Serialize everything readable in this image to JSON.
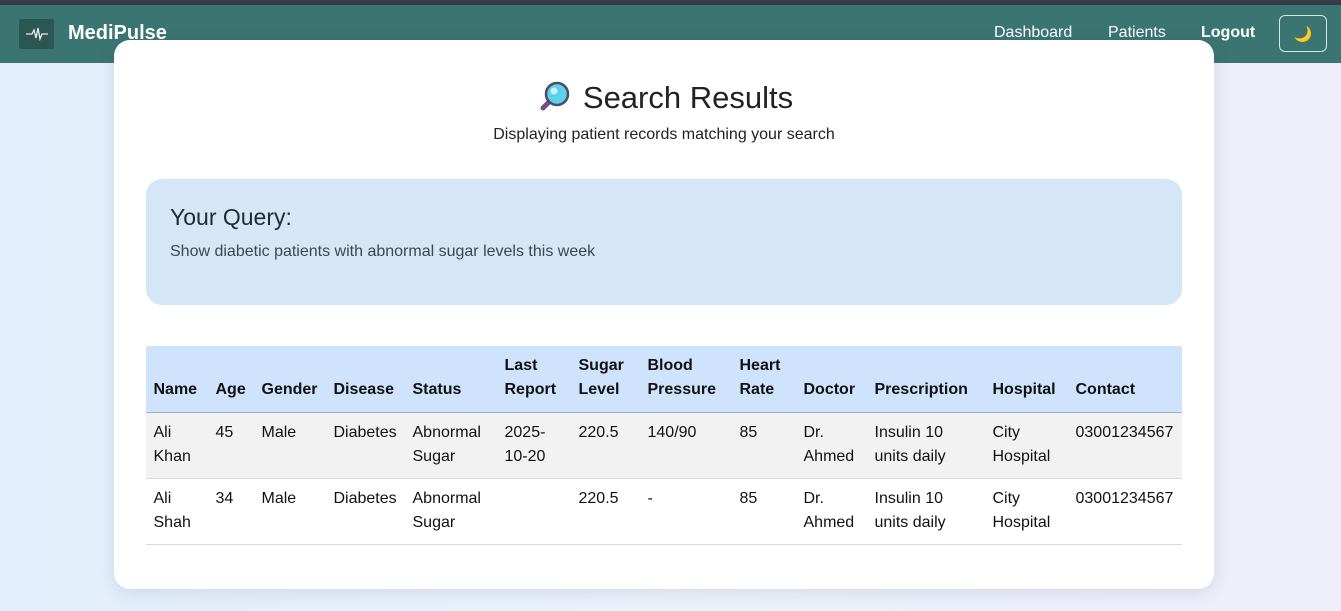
{
  "nav": {
    "brand": "MediPulse",
    "links": [
      "Dashboard",
      "Patients"
    ],
    "logout": "Logout",
    "theme_icon": "🌙"
  },
  "page": {
    "title": "Search Results",
    "subtitle": "Displaying patient records matching your search"
  },
  "query": {
    "heading": "Your Query:",
    "text": "Show diabetic patients with abnormal sugar levels this week"
  },
  "table": {
    "headers": [
      "Name",
      "Age",
      "Gender",
      "Disease",
      "Status",
      "Last Report",
      "Sugar Level",
      "Blood Pressure",
      "Heart Rate",
      "Doctor",
      "Prescription",
      "Hospital",
      "Contact"
    ],
    "rows": [
      [
        "Ali Khan",
        "45",
        "Male",
        "Diabetes",
        "Abnormal Sugar",
        "2025-10-20",
        "220.5",
        "140/90",
        "85",
        "Dr. Ahmed",
        "Insulin 10 units daily",
        "City Hospital",
        "03001234567"
      ],
      [
        "Ali Shah",
        "34",
        "Male",
        "Diabetes",
        "Abnormal Sugar",
        "",
        "220.5",
        "-",
        "85",
        "Dr. Ahmed",
        "Insulin 10 units daily",
        "City Hospital",
        "03001234567"
      ]
    ]
  }
}
